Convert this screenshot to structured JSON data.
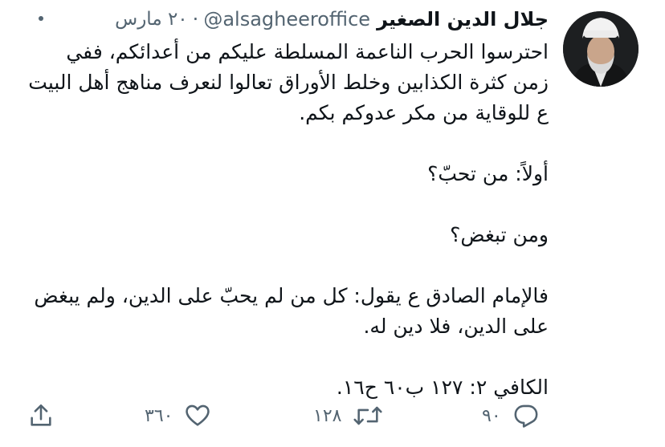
{
  "tweet": {
    "author_name": "جلال الدين الصغير",
    "handle": "@alsagheeroffice",
    "separator": "·",
    "date": "٢٠ مارس",
    "paragraphs": [
      "احترسوا الحرب الناعمة المسلطة عليكم من أعدائكم، ففي زمن كثرة الكذابين وخلط الأوراق تعالوا لنعرف مناهج أهل البيت ع للوقاية من مكر عدوكم بكم.",
      "أولاً: من تحبّ؟",
      "ومن تبغض؟",
      "فالإمام الصادق ع يقول: كل من لم يحبّ على الدين، ولم يبغض على الدين، فلا دين له.",
      "الكافي ٢: ١٢٧ ب٦٠ ح١٦."
    ]
  },
  "actions": {
    "reply_count": "٩٠",
    "retweet_count": "١٢٨",
    "like_count": "٣٦٠"
  },
  "icons": {
    "more": "more-horizontal-icon",
    "reply": "reply-icon",
    "retweet": "retweet-icon",
    "like": "heart-icon",
    "share": "share-icon"
  },
  "colors": {
    "text": "#0f1419",
    "secondary": "#536471"
  }
}
